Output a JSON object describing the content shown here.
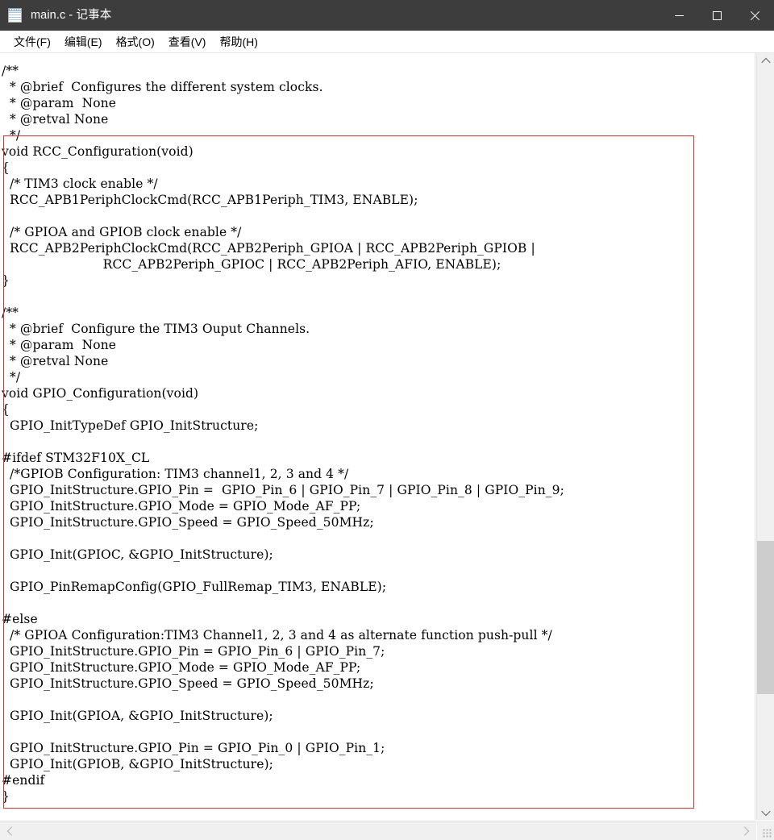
{
  "window": {
    "title": "main.c - 记事本",
    "icon": "notepad-icon",
    "titlebar_color": "#3d3d3d",
    "controls": {
      "minimize": "minimize-icon",
      "maximize": "maximize-icon",
      "close": "close-icon"
    }
  },
  "menubar": {
    "items": [
      {
        "label": "文件(F)"
      },
      {
        "label": "编辑(E)"
      },
      {
        "label": "格式(O)"
      },
      {
        "label": "查看(V)"
      },
      {
        "label": "帮助(H)"
      }
    ]
  },
  "editor": {
    "content": "/**\n  * @brief  Configures the different system clocks.\n  * @param  None\n  * @retval None\n  */\nvoid RCC_Configuration(void)\n{\n  /* TIM3 clock enable */\n  RCC_APB1PeriphClockCmd(RCC_APB1Periph_TIM3, ENABLE);\n\n  /* GPIOA and GPIOB clock enable */\n  RCC_APB2PeriphClockCmd(RCC_APB2Periph_GPIOA | RCC_APB2Periph_GPIOB |\n                         RCC_APB2Periph_GPIOC | RCC_APB2Periph_AFIO, ENABLE);\n}\n\n/**\n  * @brief  Configure the TIM3 Ouput Channels.\n  * @param  None\n  * @retval None\n  */\nvoid GPIO_Configuration(void)\n{\n  GPIO_InitTypeDef GPIO_InitStructure;\n\n#ifdef STM32F10X_CL\n  /*GPIOB Configuration: TIM3 channel1, 2, 3 and 4 */\n  GPIO_InitStructure.GPIO_Pin =  GPIO_Pin_6 | GPIO_Pin_7 | GPIO_Pin_8 | GPIO_Pin_9;\n  GPIO_InitStructure.GPIO_Mode = GPIO_Mode_AF_PP;\n  GPIO_InitStructure.GPIO_Speed = GPIO_Speed_50MHz;\n\n  GPIO_Init(GPIOC, &GPIO_InitStructure);\n\n  GPIO_PinRemapConfig(GPIO_FullRemap_TIM3, ENABLE);\n\n#else\n  /* GPIOA Configuration:TIM3 Channel1, 2, 3 and 4 as alternate function push-pull */\n  GPIO_InitStructure.GPIO_Pin = GPIO_Pin_6 | GPIO_Pin_7;\n  GPIO_InitStructure.GPIO_Mode = GPIO_Mode_AF_PP;\n  GPIO_InitStructure.GPIO_Speed = GPIO_Speed_50MHz;\n\n  GPIO_Init(GPIOA, &GPIO_InitStructure);\n\n  GPIO_InitStructure.GPIO_Pin = GPIO_Pin_0 | GPIO_Pin_1;\n  GPIO_Init(GPIOB, &GPIO_InitStructure);\n#endif\n}",
    "annotation": {
      "type": "rectangle",
      "color": "#e8302a"
    }
  },
  "scrollbars": {
    "vertical": {
      "up_arrow": "chevron-up-icon",
      "down_arrow": "chevron-down-icon",
      "thumb_color": "#cdcdcd",
      "track_color": "#f0f0f0"
    },
    "horizontal": {
      "left_arrow": "chevron-left-icon",
      "right_arrow": "chevron-right-icon",
      "track_color": "#f0f0f0"
    },
    "resize_grip": "resize-grip-icon"
  }
}
